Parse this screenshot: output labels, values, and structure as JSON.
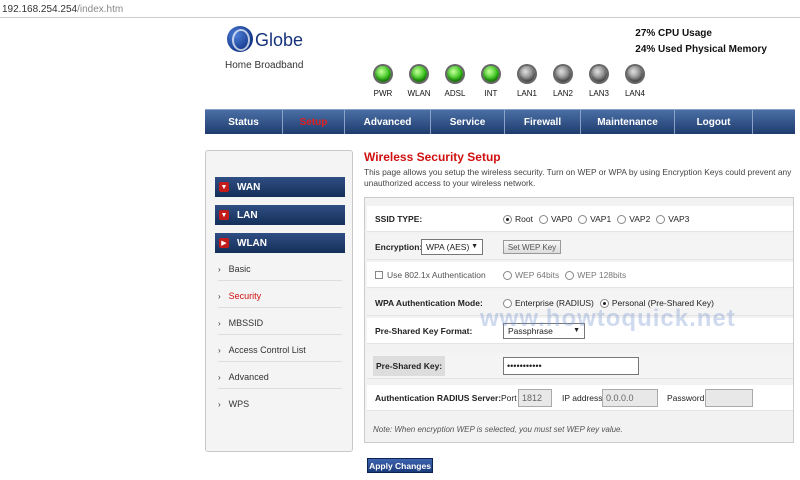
{
  "browser": {
    "url_host": "192.168.254.254",
    "url_path": "/index.htm"
  },
  "brand": {
    "name": "Globe",
    "sub": "Home Broadband"
  },
  "stats": {
    "cpu": "27% CPU Usage",
    "mem": "24% Used Physical Memory"
  },
  "leds": [
    {
      "label": "PWR",
      "state": "on"
    },
    {
      "label": "WLAN",
      "state": "on"
    },
    {
      "label": "ADSL",
      "state": "on"
    },
    {
      "label": "INT",
      "state": "on"
    },
    {
      "label": "LAN1",
      "state": "off"
    },
    {
      "label": "LAN2",
      "state": "off"
    },
    {
      "label": "LAN3",
      "state": "off"
    },
    {
      "label": "LAN4",
      "state": "off"
    }
  ],
  "nav": [
    "Status",
    "Setup",
    "Advanced",
    "Service",
    "Firewall",
    "Maintenance",
    "Logout"
  ],
  "nav_active": "Setup",
  "sidebar": {
    "groups": [
      "WAN",
      "LAN",
      "WLAN"
    ],
    "items": [
      "Basic",
      "Security",
      "MBSSID",
      "Access Control List",
      "Advanced",
      "WPS"
    ],
    "active": "Security"
  },
  "page": {
    "title": "Wireless Security Setup",
    "description": "This page allows you setup the wireless security. Turn on WEP or WPA by using Encryption Keys could prevent any unauthorized access to your wireless network."
  },
  "form": {
    "ssid_type_label": "SSID TYPE:",
    "ssid_options": [
      "Root",
      "VAP0",
      "VAP1",
      "VAP2",
      "VAP3"
    ],
    "ssid_selected": "Root",
    "encryption_label": "Encryption:",
    "encryption_value": "WPA (AES)",
    "set_wep_key": "Set WEP Key",
    "use_8021x_label": "Use 802.1x Authentication",
    "wep64": "WEP 64bits",
    "wep128": "WEP 128bits",
    "wpa_auth_label": "WPA Authentication Mode:",
    "wpa_enterprise": "Enterprise (RADIUS)",
    "wpa_personal": "Personal (Pre-Shared Key)",
    "psk_format_label": "Pre-Shared Key Format:",
    "psk_format_value": "Passphrase",
    "psk_label": "Pre-Shared Key:",
    "psk_value": "•••••••••••",
    "radius_label": "Authentication RADIUS Server:",
    "port_label": "Port",
    "port_value": "1812",
    "ip_label": "IP address",
    "ip_value": "0.0.0.0",
    "password_label": "Password",
    "password_value": "",
    "note": "Note: When encryption WEP is selected, you must set WEP key value."
  },
  "apply_label": "Apply Changes",
  "watermark": "www.howtoquick.net"
}
